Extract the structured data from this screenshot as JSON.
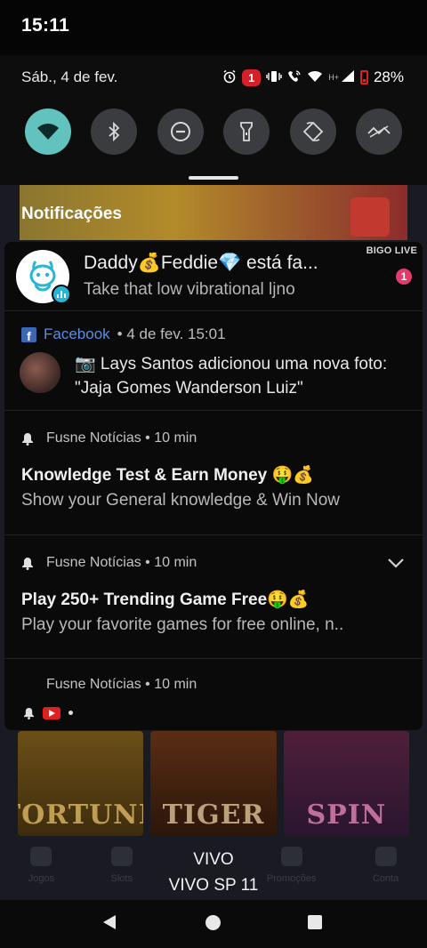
{
  "status_bar": {
    "time": "15:11"
  },
  "quick_settings": {
    "date": "Sáb., 4 de fev.",
    "alarm_icon": "alarm-icon",
    "notification_badge": "1",
    "network_label": "H+",
    "battery": "28%",
    "tiles": [
      {
        "name": "wifi-icon",
        "active": true
      },
      {
        "name": "bluetooth-icon",
        "active": false
      },
      {
        "name": "do-not-disturb-icon",
        "active": false
      },
      {
        "name": "flashlight-icon",
        "active": false
      },
      {
        "name": "auto-rotate-icon",
        "active": false
      },
      {
        "name": "data-saver-icon",
        "active": false
      }
    ]
  },
  "notifications_title": "Notificações",
  "notifications": {
    "bigo": {
      "title": "Daddy💰Feddie💎 está fa...",
      "text": "Take that low vibrational ljno",
      "app": "BIGO LIVE",
      "count": "1"
    },
    "facebook": {
      "app": "Facebook",
      "meta": "• 4 de fev. 15:01",
      "text": "📷 Lays Santos adicionou uma nova foto: \"Jaja Gomes Wanderson Luiz\""
    },
    "fusne1": {
      "app": "Fusne Notícias",
      "meta": "• 10 min",
      "title": "Knowledge Test & Earn Money 🤑💰",
      "body": "Show your General knowledge & Win Now"
    },
    "fusne2": {
      "app": "Fusne Notícias",
      "meta": "• 10 min",
      "title": "Play 250+ Trending Game Free🤑💰",
      "body": " Play your favorite games for free online, n.."
    },
    "fusne3": {
      "app": "Fusne Notícias",
      "meta": "• 10 min"
    }
  },
  "background_app": {
    "tiles": [
      "FORTUNE",
      "TIGER",
      "SPIN"
    ],
    "tabs": [
      "Jogos",
      "Slots",
      "",
      "Promoções",
      "Conta"
    ]
  },
  "carrier": {
    "line1": "VIVO",
    "line2": "VIVO SP 11"
  },
  "colors": {
    "accent": "#62c2bd",
    "facebook": "#5b8ee0",
    "badge_red": "#d4202a",
    "bigo_pink": "#e13a6b"
  }
}
